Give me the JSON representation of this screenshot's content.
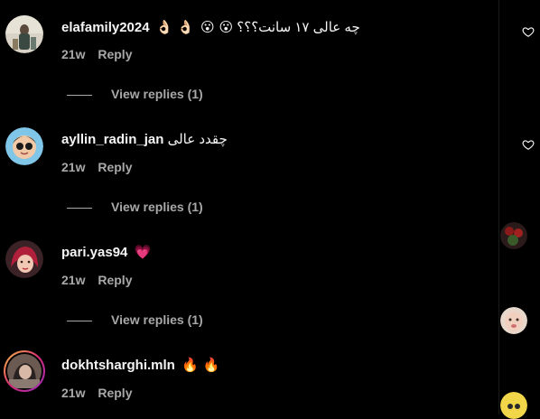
{
  "comments": [
    {
      "username": "elafamily2024",
      "text": "چه عالی ۱۷ سانت؟؟؟",
      "emojis_before": "👌🏻 👌🏻",
      "emojis_after": "😮 😮",
      "time": "21w",
      "reply_label": "Reply",
      "view_replies": "View replies (1)",
      "has_like": true
    },
    {
      "username": "ayllin_radin_jan",
      "text": "چقدد عالی",
      "time": "21w",
      "reply_label": "Reply",
      "view_replies": "View replies (1)",
      "has_like": true
    },
    {
      "username": "pari.yas94",
      "text": "",
      "emojis_after": "💗",
      "time": "21w",
      "reply_label": "Reply",
      "view_replies": "View replies (1)",
      "has_like": false
    },
    {
      "username": "dokhtsharghi.mln",
      "text": "",
      "emojis_after": "🔥 🔥",
      "time": "21w",
      "reply_label": "Reply",
      "has_like": false
    }
  ],
  "icons": {
    "like": "heart-outline-icon"
  },
  "colors": {
    "background": "#000000",
    "text_primary": "#f5f5f5",
    "text_secondary": "#a8a8a8",
    "story_ring": "#c13584"
  }
}
